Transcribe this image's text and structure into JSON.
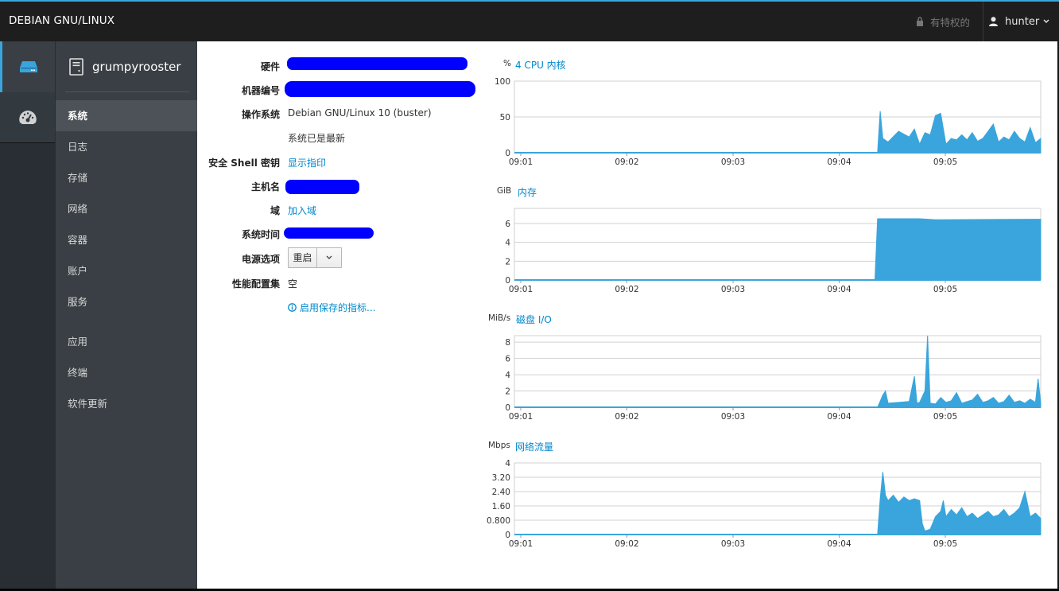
{
  "topbar": {
    "brand": "DEBIAN GNU/LINUX",
    "privileged": "有特权的",
    "user": "hunter"
  },
  "iconbar": {
    "items": [
      "host-icon",
      "dashboard-icon"
    ]
  },
  "host": {
    "name": "grumpyrooster"
  },
  "nav": {
    "items": [
      {
        "label": "系统",
        "active": true
      },
      {
        "label": "日志"
      },
      {
        "label": "存储"
      },
      {
        "label": "网络"
      },
      {
        "label": "容器"
      },
      {
        "label": "账户"
      },
      {
        "label": "服务"
      },
      {
        "label": "应用"
      },
      {
        "label": "终端"
      },
      {
        "label": "软件更新"
      }
    ]
  },
  "system": {
    "hardware_label": "硬件",
    "machine_id_label": "机器编号",
    "os_label": "操作系统",
    "os_value": "Debian GNU/Linux 10 (buster)",
    "updates_value": "系统已是最新",
    "ssh_label": "安全 Shell 密钥",
    "ssh_link": "显示指印",
    "hostname_label": "主机名",
    "domain_label": "域",
    "domain_link": "加入域",
    "time_label": "系统时间",
    "power_label": "电源选项",
    "power_button": "重启",
    "profile_label": "性能配置集",
    "profile_value": "空",
    "metrics_link": "启用保存的指标..."
  },
  "chart_data": [
    {
      "type": "area",
      "unit": "%",
      "title": "4 CPU 内核",
      "yticks": [
        "100",
        "50",
        "0"
      ],
      "ylim": [
        0,
        100
      ],
      "xticks": [
        "09:01",
        "09:02",
        "09:03",
        "09:04",
        "09:05"
      ],
      "color": "#39a5dc",
      "x": [
        0,
        0.69,
        0.695,
        0.7,
        0.71,
        0.73,
        0.75,
        0.76,
        0.77,
        0.78,
        0.79,
        0.8,
        0.81,
        0.82,
        0.83,
        0.84,
        0.85,
        0.86,
        0.87,
        0.88,
        0.89,
        0.9,
        0.91,
        0.92,
        0.93,
        0.94,
        0.95,
        0.96,
        0.97,
        0.98,
        0.99,
        1.0
      ],
      "values": [
        0,
        0,
        58,
        20,
        15,
        30,
        22,
        33,
        12,
        28,
        25,
        52,
        55,
        12,
        20,
        18,
        25,
        18,
        28,
        16,
        20,
        30,
        40,
        15,
        22,
        18,
        30,
        20,
        15,
        35,
        14,
        20
      ]
    },
    {
      "type": "area",
      "unit": "GiB",
      "title": "内存",
      "yticks": [
        "6",
        "4",
        "2",
        "0"
      ],
      "ylim": [
        0,
        7.6
      ],
      "xticks": [
        "09:01",
        "09:02",
        "09:03",
        "09:04",
        "09:05"
      ],
      "color": "#39a5dc",
      "x": [
        0,
        0.685,
        0.69,
        0.77,
        0.8,
        1.0
      ],
      "values": [
        0,
        0,
        6.5,
        6.5,
        6.4,
        6.45
      ]
    },
    {
      "type": "area",
      "unit": "MiB/s",
      "title": "磁盘 I/O",
      "yticks": [
        "8",
        "6",
        "4",
        "2",
        "0"
      ],
      "ylim": [
        0,
        8.8
      ],
      "xticks": [
        "09:01",
        "09:02",
        "09:03",
        "09:04",
        "09:05"
      ],
      "color": "#39a5dc",
      "x": [
        0,
        0.69,
        0.7,
        0.705,
        0.71,
        0.73,
        0.75,
        0.76,
        0.765,
        0.77,
        0.78,
        0.785,
        0.79,
        0.8,
        0.81,
        0.82,
        0.83,
        0.84,
        0.85,
        0.86,
        0.87,
        0.88,
        0.89,
        0.9,
        0.91,
        0.92,
        0.93,
        0.94,
        0.95,
        0.96,
        0.97,
        0.98,
        0.99,
        0.995,
        1.0
      ],
      "values": [
        0,
        0,
        1.5,
        2.0,
        0.5,
        0.6,
        0.7,
        3.8,
        0.5,
        0.6,
        2.0,
        8.8,
        0.5,
        0.4,
        1.2,
        0.6,
        0.8,
        1.8,
        0.5,
        0.7,
        0.9,
        1.6,
        0.6,
        0.8,
        1.2,
        0.5,
        0.7,
        1.5,
        0.6,
        0.8,
        0.5,
        1.0,
        0.6,
        3.5,
        0.5
      ]
    },
    {
      "type": "area",
      "unit": "Mbps",
      "title": "网络流量",
      "yticks": [
        "4",
        "3.20",
        "2.40",
        "1.60",
        "0.800",
        "0"
      ],
      "ylim": [
        0,
        4
      ],
      "xticks": [
        "09:01",
        "09:02",
        "09:03",
        "09:04",
        "09:05"
      ],
      "color": "#39a5dc",
      "x": [
        0,
        0.69,
        0.695,
        0.7,
        0.705,
        0.71,
        0.72,
        0.73,
        0.74,
        0.75,
        0.76,
        0.77,
        0.775,
        0.78,
        0.79,
        0.8,
        0.81,
        0.815,
        0.82,
        0.83,
        0.84,
        0.85,
        0.86,
        0.87,
        0.88,
        0.89,
        0.9,
        0.91,
        0.92,
        0.93,
        0.94,
        0.95,
        0.96,
        0.97,
        0.98,
        0.99,
        1.0
      ],
      "values": [
        0,
        0,
        2.0,
        3.5,
        2.2,
        1.9,
        2.2,
        1.8,
        2.1,
        1.9,
        2.0,
        1.9,
        0.6,
        0.2,
        0.3,
        1.0,
        1.3,
        1.9,
        1.0,
        1.4,
        1.1,
        1.5,
        1.0,
        1.2,
        0.9,
        1.1,
        1.3,
        1.0,
        1.1,
        1.4,
        1.0,
        1.2,
        1.5,
        2.4,
        1.0,
        1.2,
        0.9
      ]
    }
  ]
}
